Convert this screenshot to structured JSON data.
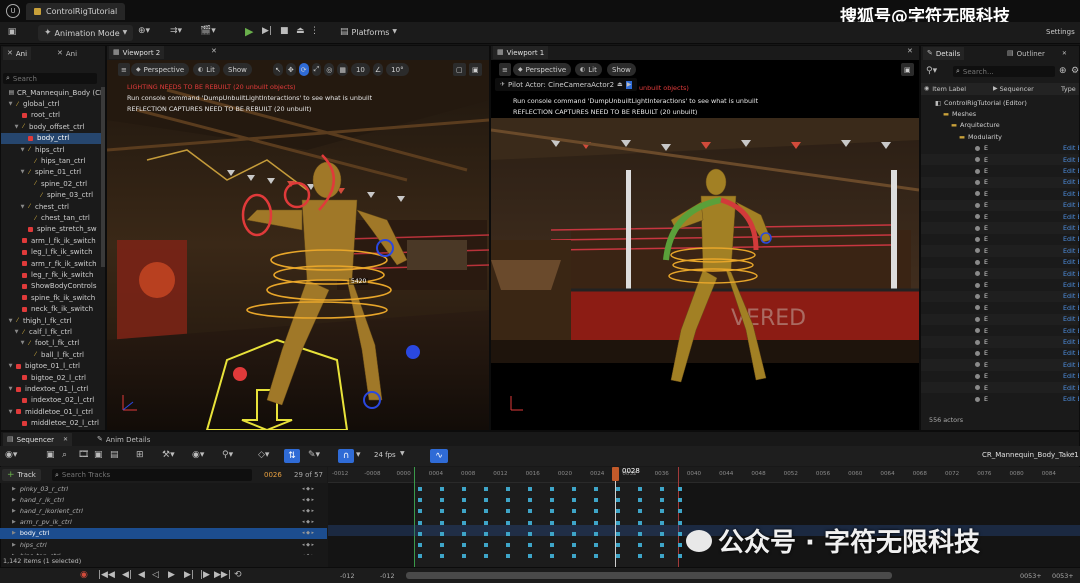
{
  "window": {
    "document_tab": "ControlRigTutorial",
    "watermark_top": "搜狐号@字符无限科技",
    "watermark_bottom": "公众号 · 字符无限科技",
    "settings_label": "Settings"
  },
  "toolbar": {
    "mode_label": "Animation Mode",
    "platforms_label": "Platforms"
  },
  "left_tabs": [
    "Ani",
    "Ani"
  ],
  "search_placeholder": "Search",
  "hierarchy": [
    {
      "label": "CR_Mannequin_Body (CR",
      "indent": 0,
      "kind": "root"
    },
    {
      "label": "global_ctrl",
      "indent": 1,
      "kind": "bone",
      "arrow": true
    },
    {
      "label": "root_ctrl",
      "indent": 2,
      "kind": "ctl"
    },
    {
      "label": "body_offset_ctrl",
      "indent": 2,
      "kind": "bone",
      "arrow": true
    },
    {
      "label": "body_ctrl",
      "indent": 3,
      "kind": "ctl",
      "selected": true
    },
    {
      "label": "hips_ctrl",
      "indent": 3,
      "kind": "bone",
      "arrow": true
    },
    {
      "label": "hips_tan_ctrl",
      "indent": 4,
      "kind": "bone"
    },
    {
      "label": "spine_01_ctrl",
      "indent": 3,
      "kind": "bone",
      "arrow": true
    },
    {
      "label": "spine_02_ctrl",
      "indent": 4,
      "kind": "bone"
    },
    {
      "label": "spine_03_ctrl",
      "indent": 5,
      "kind": "bone"
    },
    {
      "label": "chest_ctrl",
      "indent": 3,
      "kind": "bone",
      "arrow": true
    },
    {
      "label": "chest_tan_ctrl",
      "indent": 4,
      "kind": "bone"
    },
    {
      "label": "spine_stretch_sw",
      "indent": 3,
      "kind": "ctl"
    },
    {
      "label": "arm_l_fk_ik_switch",
      "indent": 2,
      "kind": "ctl"
    },
    {
      "label": "leg_l_fk_ik_switch",
      "indent": 2,
      "kind": "ctl"
    },
    {
      "label": "arm_r_fk_ik_switch",
      "indent": 2,
      "kind": "ctl"
    },
    {
      "label": "leg_r_fk_ik_switch",
      "indent": 2,
      "kind": "ctl"
    },
    {
      "label": "ShowBodyControls",
      "indent": 2,
      "kind": "ctl"
    },
    {
      "label": "spine_fk_ik_switch",
      "indent": 2,
      "kind": "ctl"
    },
    {
      "label": "neck_fk_ik_switch",
      "indent": 2,
      "kind": "ctl"
    },
    {
      "label": "thigh_l_fk_ctrl",
      "indent": 1,
      "kind": "bone",
      "arrow": true
    },
    {
      "label": "calf_l_fk_ctrl",
      "indent": 2,
      "kind": "bone",
      "arrow": true
    },
    {
      "label": "foot_l_fk_ctrl",
      "indent": 3,
      "kind": "bone",
      "arrow": true
    },
    {
      "label": "ball_l_fk_ctrl",
      "indent": 4,
      "kind": "bone"
    },
    {
      "label": "bigtoe_01_l_ctrl",
      "indent": 1,
      "kind": "ctl",
      "arrow": true
    },
    {
      "label": "bigtoe_02_l_ctrl",
      "indent": 2,
      "kind": "ctl"
    },
    {
      "label": "indextoe_01_l_ctrl",
      "indent": 1,
      "kind": "ctl",
      "arrow": true
    },
    {
      "label": "indextoe_02_l_ctrl",
      "indent": 2,
      "kind": "ctl"
    },
    {
      "label": "middletoe_01_l_ctrl",
      "indent": 1,
      "kind": "ctl",
      "arrow": true
    },
    {
      "label": "middletoe_02_l_ctrl",
      "indent": 2,
      "kind": "ctl"
    }
  ],
  "viewport2": {
    "tab": "Viewport 2",
    "perspective": "Perspective",
    "lit": "Lit",
    "show": "Show",
    "grid_value": "10",
    "angle_value": "10°",
    "warning": "LIGHTING NEEDS TO BE REBUILT (20 unbuilt objects)",
    "msg1": "Run console command 'DumpUnbuiltLightInteractions' to see what is unbuilt",
    "msg2": "REFLECTION CAPTURES NEED TO BE REBUILT (20 unbuilt)",
    "readout": "5420"
  },
  "viewport1": {
    "tab": "Viewport 1",
    "perspective": "Perspective",
    "lit": "Lit",
    "show": "Show",
    "pilot": "Pilot Actor: CineCameraActor2",
    "warning": "unbuilt objects)",
    "msg1": "Run console command 'DumpUnbuiltLightInteractions' to see what is unbuilt",
    "msg2": "REFLECTION CAPTURES NEED TO BE REBUILT (20 unbuilt)"
  },
  "outliner": {
    "tabs": [
      "Details",
      "Outliner"
    ],
    "search_placeholder": "Search...",
    "col_label": "Item Label",
    "col_seq": "Sequencer",
    "col_type": "Type",
    "tree": [
      "ControlRigTutorial (Editor)",
      "Meshes",
      "Arquitecture",
      "Modularity"
    ],
    "item_prefix": "E",
    "edit": "Edit E",
    "item_count": 23,
    "footer": "556 actors"
  },
  "sequencer": {
    "tabs": [
      "Sequencer",
      "Anim Details"
    ],
    "fps": "24 fps",
    "sequence_name": "CR_Mannequin_Body_Take1",
    "add_track": "Track",
    "search_placeholder": "Search Tracks",
    "frame_current": "0026",
    "frame_of": "29 of 57",
    "playhead_frame": "0028",
    "tracks": [
      {
        "label": "pinky_03_r_ctrl",
        "indent": 1
      },
      {
        "label": "hand_r_ik_ctrl",
        "indent": 1
      },
      {
        "label": "hand_r_ikorient_ctrl",
        "indent": 1
      },
      {
        "label": "arm_r_pv_ik_ctrl",
        "indent": 1
      },
      {
        "label": "body_ctrl",
        "indent": 1,
        "selected": true
      },
      {
        "label": "hips_ctrl",
        "indent": 1
      },
      {
        "label": "hips_tan_ctrl",
        "indent": 1
      }
    ],
    "status": "1,142 items (1 selected)",
    "ruler": [
      "-0012",
      "-0008",
      "0000",
      "0004",
      "0008",
      "0012",
      "0016",
      "0020",
      "0024",
      "0032",
      "0036",
      "0040",
      "0044",
      "0048",
      "0052",
      "0056",
      "0060",
      "0064",
      "0068",
      "0072",
      "0076",
      "0080",
      "0084"
    ],
    "start_label": "-012",
    "start_label2": "-012",
    "end_label": "0053+",
    "end_label2": "0053+"
  }
}
